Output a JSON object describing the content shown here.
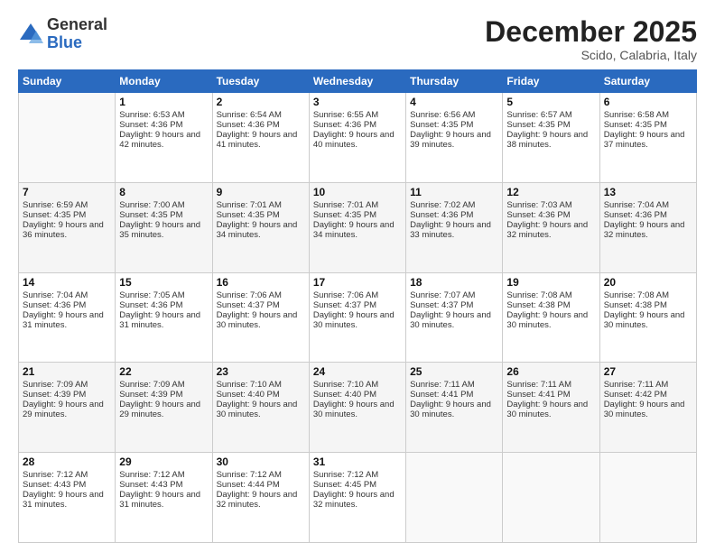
{
  "logo": {
    "general": "General",
    "blue": "Blue"
  },
  "header": {
    "month": "December 2025",
    "location": "Scido, Calabria, Italy"
  },
  "days": [
    "Sunday",
    "Monday",
    "Tuesday",
    "Wednesday",
    "Thursday",
    "Friday",
    "Saturday"
  ],
  "weeks": [
    [
      {
        "num": "",
        "sunrise": "",
        "sunset": "",
        "daylight": ""
      },
      {
        "num": "1",
        "sunrise": "Sunrise: 6:53 AM",
        "sunset": "Sunset: 4:36 PM",
        "daylight": "Daylight: 9 hours and 42 minutes."
      },
      {
        "num": "2",
        "sunrise": "Sunrise: 6:54 AM",
        "sunset": "Sunset: 4:36 PM",
        "daylight": "Daylight: 9 hours and 41 minutes."
      },
      {
        "num": "3",
        "sunrise": "Sunrise: 6:55 AM",
        "sunset": "Sunset: 4:36 PM",
        "daylight": "Daylight: 9 hours and 40 minutes."
      },
      {
        "num": "4",
        "sunrise": "Sunrise: 6:56 AM",
        "sunset": "Sunset: 4:35 PM",
        "daylight": "Daylight: 9 hours and 39 minutes."
      },
      {
        "num": "5",
        "sunrise": "Sunrise: 6:57 AM",
        "sunset": "Sunset: 4:35 PM",
        "daylight": "Daylight: 9 hours and 38 minutes."
      },
      {
        "num": "6",
        "sunrise": "Sunrise: 6:58 AM",
        "sunset": "Sunset: 4:35 PM",
        "daylight": "Daylight: 9 hours and 37 minutes."
      }
    ],
    [
      {
        "num": "7",
        "sunrise": "Sunrise: 6:59 AM",
        "sunset": "Sunset: 4:35 PM",
        "daylight": "Daylight: 9 hours and 36 minutes."
      },
      {
        "num": "8",
        "sunrise": "Sunrise: 7:00 AM",
        "sunset": "Sunset: 4:35 PM",
        "daylight": "Daylight: 9 hours and 35 minutes."
      },
      {
        "num": "9",
        "sunrise": "Sunrise: 7:01 AM",
        "sunset": "Sunset: 4:35 PM",
        "daylight": "Daylight: 9 hours and 34 minutes."
      },
      {
        "num": "10",
        "sunrise": "Sunrise: 7:01 AM",
        "sunset": "Sunset: 4:35 PM",
        "daylight": "Daylight: 9 hours and 34 minutes."
      },
      {
        "num": "11",
        "sunrise": "Sunrise: 7:02 AM",
        "sunset": "Sunset: 4:36 PM",
        "daylight": "Daylight: 9 hours and 33 minutes."
      },
      {
        "num": "12",
        "sunrise": "Sunrise: 7:03 AM",
        "sunset": "Sunset: 4:36 PM",
        "daylight": "Daylight: 9 hours and 32 minutes."
      },
      {
        "num": "13",
        "sunrise": "Sunrise: 7:04 AM",
        "sunset": "Sunset: 4:36 PM",
        "daylight": "Daylight: 9 hours and 32 minutes."
      }
    ],
    [
      {
        "num": "14",
        "sunrise": "Sunrise: 7:04 AM",
        "sunset": "Sunset: 4:36 PM",
        "daylight": "Daylight: 9 hours and 31 minutes."
      },
      {
        "num": "15",
        "sunrise": "Sunrise: 7:05 AM",
        "sunset": "Sunset: 4:36 PM",
        "daylight": "Daylight: 9 hours and 31 minutes."
      },
      {
        "num": "16",
        "sunrise": "Sunrise: 7:06 AM",
        "sunset": "Sunset: 4:37 PM",
        "daylight": "Daylight: 9 hours and 30 minutes."
      },
      {
        "num": "17",
        "sunrise": "Sunrise: 7:06 AM",
        "sunset": "Sunset: 4:37 PM",
        "daylight": "Daylight: 9 hours and 30 minutes."
      },
      {
        "num": "18",
        "sunrise": "Sunrise: 7:07 AM",
        "sunset": "Sunset: 4:37 PM",
        "daylight": "Daylight: 9 hours and 30 minutes."
      },
      {
        "num": "19",
        "sunrise": "Sunrise: 7:08 AM",
        "sunset": "Sunset: 4:38 PM",
        "daylight": "Daylight: 9 hours and 30 minutes."
      },
      {
        "num": "20",
        "sunrise": "Sunrise: 7:08 AM",
        "sunset": "Sunset: 4:38 PM",
        "daylight": "Daylight: 9 hours and 30 minutes."
      }
    ],
    [
      {
        "num": "21",
        "sunrise": "Sunrise: 7:09 AM",
        "sunset": "Sunset: 4:39 PM",
        "daylight": "Daylight: 9 hours and 29 minutes."
      },
      {
        "num": "22",
        "sunrise": "Sunrise: 7:09 AM",
        "sunset": "Sunset: 4:39 PM",
        "daylight": "Daylight: 9 hours and 29 minutes."
      },
      {
        "num": "23",
        "sunrise": "Sunrise: 7:10 AM",
        "sunset": "Sunset: 4:40 PM",
        "daylight": "Daylight: 9 hours and 30 minutes."
      },
      {
        "num": "24",
        "sunrise": "Sunrise: 7:10 AM",
        "sunset": "Sunset: 4:40 PM",
        "daylight": "Daylight: 9 hours and 30 minutes."
      },
      {
        "num": "25",
        "sunrise": "Sunrise: 7:11 AM",
        "sunset": "Sunset: 4:41 PM",
        "daylight": "Daylight: 9 hours and 30 minutes."
      },
      {
        "num": "26",
        "sunrise": "Sunrise: 7:11 AM",
        "sunset": "Sunset: 4:41 PM",
        "daylight": "Daylight: 9 hours and 30 minutes."
      },
      {
        "num": "27",
        "sunrise": "Sunrise: 7:11 AM",
        "sunset": "Sunset: 4:42 PM",
        "daylight": "Daylight: 9 hours and 30 minutes."
      }
    ],
    [
      {
        "num": "28",
        "sunrise": "Sunrise: 7:12 AM",
        "sunset": "Sunset: 4:43 PM",
        "daylight": "Daylight: 9 hours and 31 minutes."
      },
      {
        "num": "29",
        "sunrise": "Sunrise: 7:12 AM",
        "sunset": "Sunset: 4:43 PM",
        "daylight": "Daylight: 9 hours and 31 minutes."
      },
      {
        "num": "30",
        "sunrise": "Sunrise: 7:12 AM",
        "sunset": "Sunset: 4:44 PM",
        "daylight": "Daylight: 9 hours and 32 minutes."
      },
      {
        "num": "31",
        "sunrise": "Sunrise: 7:12 AM",
        "sunset": "Sunset: 4:45 PM",
        "daylight": "Daylight: 9 hours and 32 minutes."
      },
      {
        "num": "",
        "sunrise": "",
        "sunset": "",
        "daylight": ""
      },
      {
        "num": "",
        "sunrise": "",
        "sunset": "",
        "daylight": ""
      },
      {
        "num": "",
        "sunrise": "",
        "sunset": "",
        "daylight": ""
      }
    ]
  ]
}
